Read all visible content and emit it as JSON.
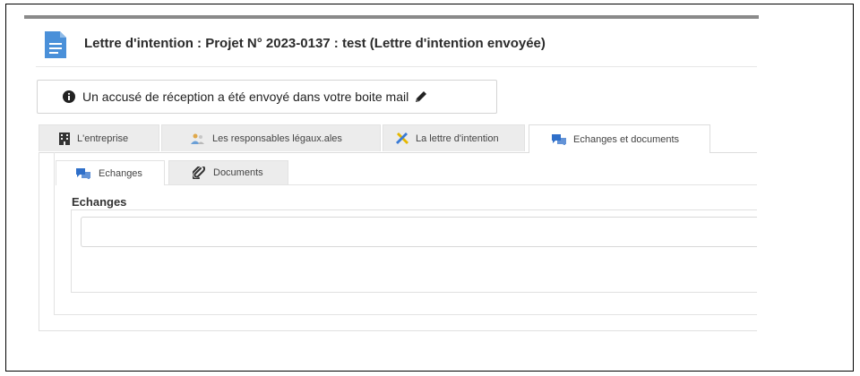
{
  "header": {
    "title": "Lettre d'intention : Projet N° 2023-0137 : test (Lettre d'intention envoyée)",
    "icon": "document-icon"
  },
  "alert": {
    "message": "Un accusé de réception a été envoyé dans votre boite mail",
    "icon": "info-circle-icon",
    "edit_icon": "pencil-icon"
  },
  "tabs": [
    {
      "label": "L'entreprise",
      "icon": "building-icon",
      "active": false
    },
    {
      "label": "Les responsables légaux.ales",
      "icon": "users-icon",
      "active": false
    },
    {
      "label": "La lettre d'intention",
      "icon": "tools-icon",
      "active": false
    },
    {
      "label": "Echanges et documents",
      "icon": "comments-icon",
      "active": true
    }
  ],
  "subtabs": [
    {
      "label": "Echanges",
      "icon": "comments-icon",
      "active": true
    },
    {
      "label": "Documents",
      "icon": "paperclip-icon",
      "active": false
    }
  ],
  "section": {
    "title": "Echanges",
    "input_value": ""
  },
  "colors": {
    "doc_icon": "#4a90d9",
    "comments_icon": "#2f6fc9",
    "tools_blue": "#3a7bd5",
    "tools_yellow": "#e6b800",
    "tab_inactive": "#ececec"
  }
}
